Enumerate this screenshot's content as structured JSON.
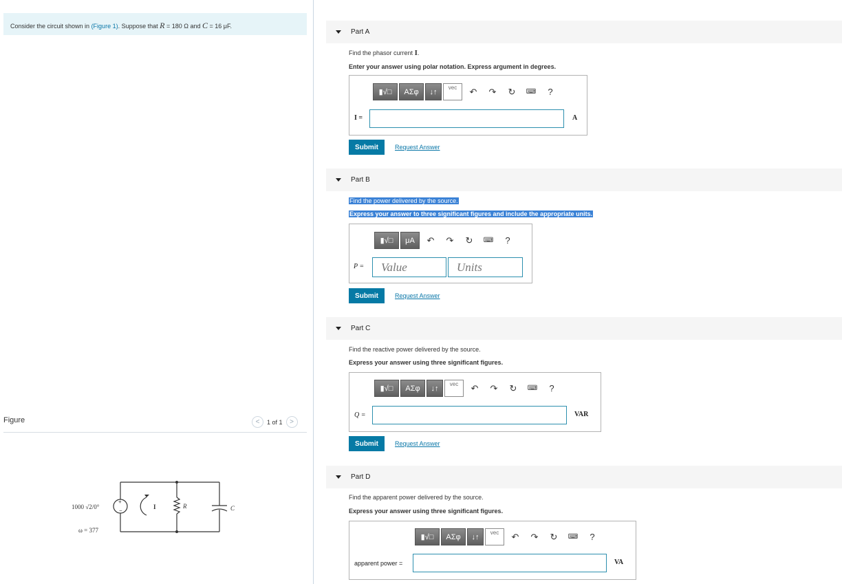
{
  "intro": {
    "prefix": "Consider the circuit shown in ",
    "figure_link": "(Figure 1)",
    "suffix_1": ". Suppose that ",
    "R_sym": "R",
    "R_val": " = 180 Ω and ",
    "C_sym": "C",
    "C_val": " = 16 μF."
  },
  "figure": {
    "label": "Figure",
    "pager": "1 of 1",
    "prev": "<",
    "next": ">",
    "source_label": "1000 √2/0°",
    "omega_label": "ω = 377",
    "current_label": "I",
    "resistor_label": "R",
    "capacitor_label": "C"
  },
  "toolbar": {
    "templates": "▮√□",
    "greek": "ΑΣφ",
    "arrows": "↓↑",
    "vec": "vec",
    "units_btn": "μA",
    "undo": "↶",
    "redo": "↷",
    "reset": "↻",
    "keyboard": "⌨",
    "help": "?"
  },
  "common": {
    "submit": "Submit",
    "request_answer": "Request Answer"
  },
  "partA": {
    "title": "Part A",
    "prompt_prefix": "Find the phasor current ",
    "prompt_var": "I",
    "prompt_suffix": ".",
    "instruction": "Enter your answer using polar notation. Express argument in degrees.",
    "label": "I =",
    "unit": "A"
  },
  "partB": {
    "title": "Part B",
    "prompt": "Find the power delivered by the source.",
    "instruction": "Express your answer to three significant figures and include the appropriate units.",
    "label": "P =",
    "value_placeholder": "Value",
    "units_placeholder": "Units"
  },
  "partC": {
    "title": "Part C",
    "prompt": "Find the reactive power delivered by the source.",
    "instruction": "Express your answer using three significant figures.",
    "label": "Q =",
    "unit": "VAR"
  },
  "partD": {
    "title": "Part D",
    "prompt": "Find the apparent power delivered by the source.",
    "instruction": "Express your answer using three significant figures.",
    "label": "apparent power =",
    "unit": "VA"
  }
}
